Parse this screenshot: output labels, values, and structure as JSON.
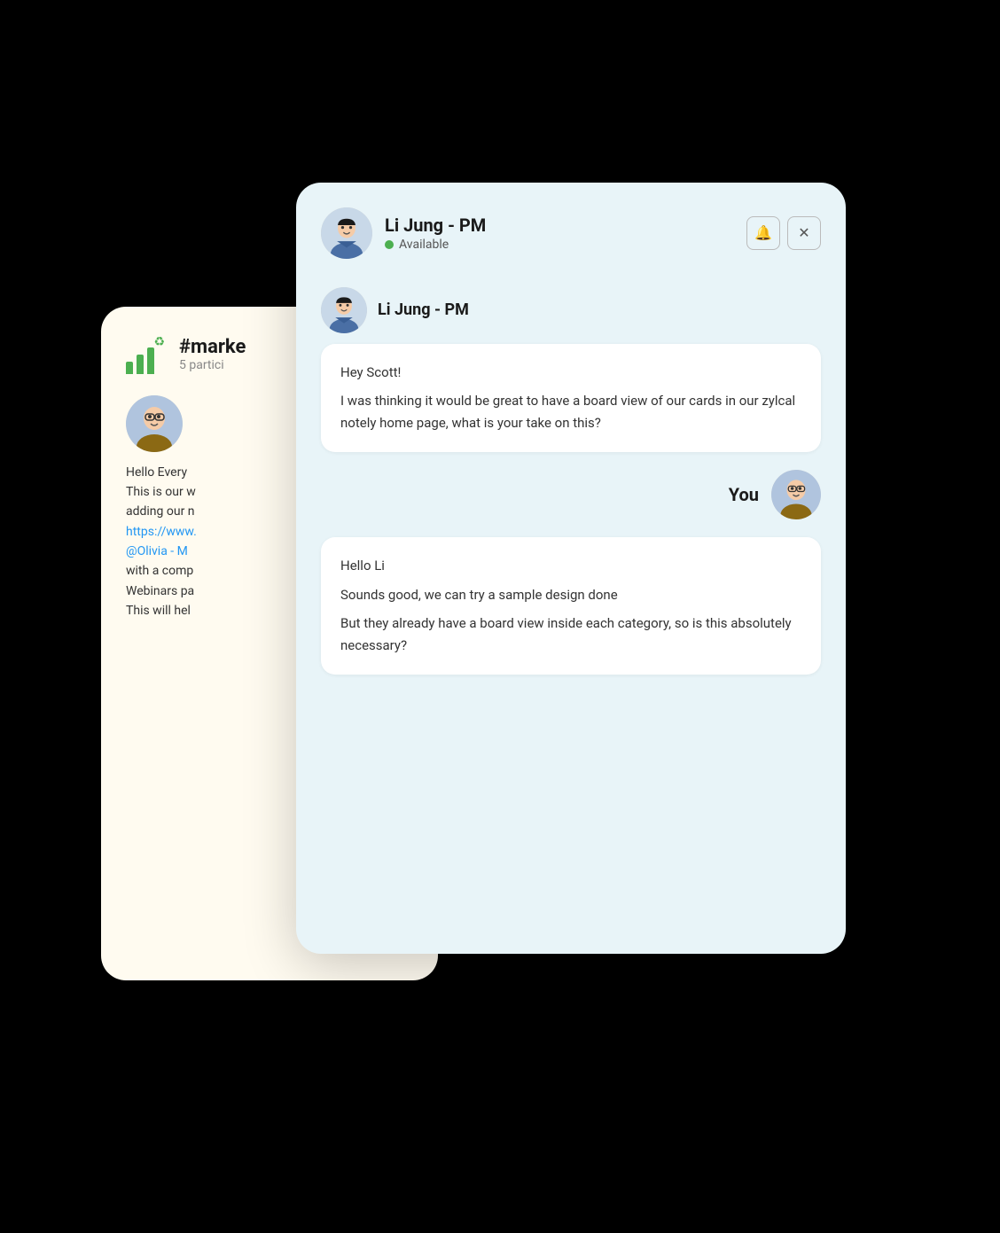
{
  "scene": {
    "background": "#000000"
  },
  "back_card": {
    "channel_name": "#marke",
    "channel_participants": "5 partici",
    "message": {
      "text_lines": [
        "Hello Every",
        "This is our w",
        "adding our n",
        "https://www.",
        "@Olivia - M",
        "with a comp",
        "Webinars pa",
        "This will hel"
      ]
    }
  },
  "front_card": {
    "header": {
      "name": "Li Jung - PM",
      "status": "Available",
      "bell_icon": "🔔",
      "close_icon": "✕"
    },
    "messages": [
      {
        "sender": "Li Jung - PM",
        "type": "received",
        "paragraphs": [
          "Hey Scott!",
          "I was thinking it would be great to have a board view of our cards in our zylcal notely home page, what is your take on this?"
        ]
      },
      {
        "sender": "You",
        "type": "sent",
        "paragraphs": [
          "Hello Li",
          "Sounds good, we can try a sample design done",
          "But they already have a board view inside each category, so is this absolutely necessary?"
        ]
      }
    ]
  }
}
